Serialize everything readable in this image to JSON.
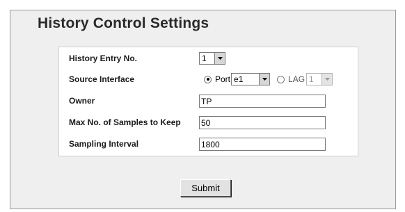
{
  "page": {
    "title": "History Control Settings"
  },
  "form": {
    "history_entry": {
      "label": "History Entry No.",
      "value": "1"
    },
    "source_interface": {
      "label": "Source Interface",
      "port_label": "Port",
      "port_value": "e1",
      "lag_label": "LAG",
      "lag_value": "1",
      "selected": "Port"
    },
    "owner": {
      "label": "Owner",
      "value": "TP"
    },
    "max_samples": {
      "label": "Max No. of Samples to Keep",
      "value": "50"
    },
    "sampling_interval": {
      "label": "Sampling Interval",
      "value": "1800"
    }
  },
  "actions": {
    "submit_label": "Submit"
  },
  "colors": {
    "panel_bg": "#efefef",
    "panel_border": "#9a9a9a",
    "title": "#2a2a2a"
  },
  "icons": {
    "select_arrow": "chevron-down-icon"
  }
}
